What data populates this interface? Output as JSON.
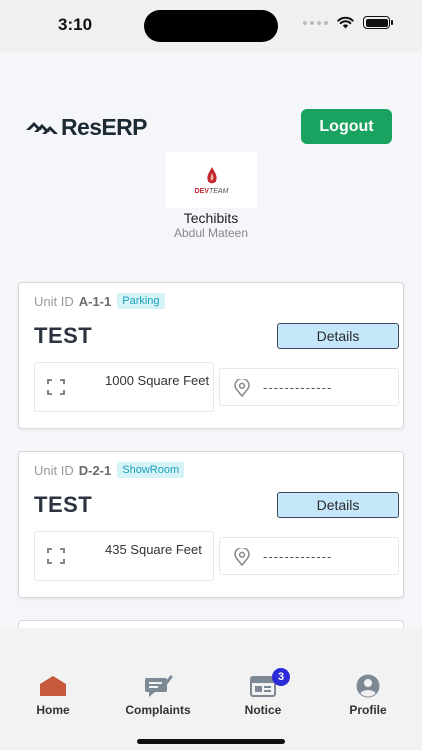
{
  "status": {
    "time": "3:10"
  },
  "brand": {
    "name": "ResERP"
  },
  "header": {
    "logout_label": "Logout",
    "logo_text_dev": "DEV",
    "logo_text_team": "TEAM",
    "company_name": "Techibits",
    "user_name": "Abdul Mateen"
  },
  "units": [
    {
      "unit_id_label": "Unit ID",
      "unit_id": "A-1-1",
      "tag": "Parking",
      "title": "TEST",
      "details_label": "Details",
      "area": "1000 Square Feet",
      "location": "-------------"
    },
    {
      "unit_id_label": "Unit ID",
      "unit_id": "D-2-1",
      "tag": "ShowRoom",
      "title": "TEST",
      "details_label": "Details",
      "area": "435 Square Feet",
      "location": "-------------"
    }
  ],
  "nav": {
    "items": [
      {
        "label": "Home",
        "icon": "home-icon"
      },
      {
        "label": "Complaints",
        "icon": "complaints-icon"
      },
      {
        "label": "Notice",
        "icon": "notice-icon",
        "badge": "3"
      },
      {
        "label": "Profile",
        "icon": "profile-icon"
      }
    ]
  },
  "colors": {
    "accent_green": "#1aa260",
    "tag_text": "#1aa0bd",
    "details_bg": "#c6e7fa",
    "home_active": "#c75a3c",
    "badge": "#2b2bd8"
  }
}
